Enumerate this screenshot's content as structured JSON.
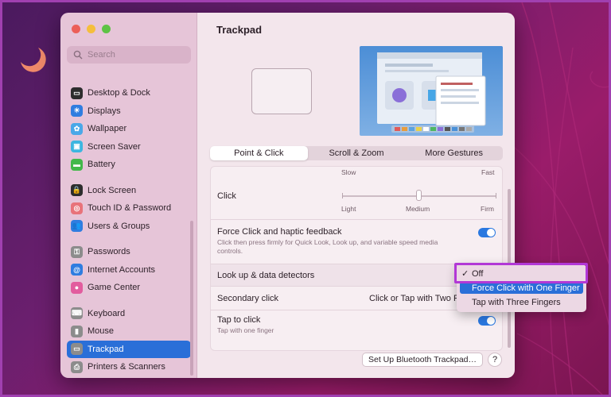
{
  "colors": {
    "accent": "#2a6fd8",
    "callout": "#b238d6",
    "traffic_close": "#ec5f58",
    "traffic_min": "#f5be3c",
    "traffic_max": "#5ec345"
  },
  "sidebar": {
    "search_placeholder": "Search",
    "items": [
      {
        "label": "Desktop & Dock",
        "icon": "dock-icon",
        "color": "#2d2d2d",
        "glyph": "▭"
      },
      {
        "label": "Displays",
        "icon": "sun-icon",
        "color": "#2f7de0",
        "glyph": "☀"
      },
      {
        "label": "Wallpaper",
        "icon": "wallpaper-icon",
        "color": "#4aa8e8",
        "glyph": "✿"
      },
      {
        "label": "Screen Saver",
        "icon": "screen-saver-icon",
        "color": "#3cb6e0",
        "glyph": "▣"
      },
      {
        "label": "Battery",
        "icon": "battery-icon",
        "color": "#42b84a",
        "glyph": "▬"
      },
      {
        "label": "Lock Screen",
        "icon": "lock-icon",
        "color": "#2d2d2d",
        "glyph": "🔒"
      },
      {
        "label": "Touch ID & Password",
        "icon": "fingerprint-icon",
        "color": "#e8737a",
        "glyph": "◎"
      },
      {
        "label": "Users & Groups",
        "icon": "users-icon",
        "color": "#2f7de0",
        "glyph": "👥"
      },
      {
        "label": "Passwords",
        "icon": "key-icon",
        "color": "#8c8c8c",
        "glyph": "⚿"
      },
      {
        "label": "Internet Accounts",
        "icon": "at-icon",
        "color": "#2f7de0",
        "glyph": "@"
      },
      {
        "label": "Game Center",
        "icon": "game-center-icon",
        "color": "#e25c9e",
        "glyph": "●"
      },
      {
        "label": "Keyboard",
        "icon": "keyboard-icon",
        "color": "#8c8c8c",
        "glyph": "⌨"
      },
      {
        "label": "Mouse",
        "icon": "mouse-icon",
        "color": "#8c8c8c",
        "glyph": "▮"
      },
      {
        "label": "Trackpad",
        "icon": "trackpad-icon",
        "color": "#8c8c8c",
        "glyph": "▭"
      },
      {
        "label": "Printers & Scanners",
        "icon": "printer-icon",
        "color": "#8c8c8c",
        "glyph": "⎙"
      }
    ]
  },
  "main": {
    "title": "Trackpad",
    "tabs": [
      "Point & Click",
      "Scroll & Zoom",
      "More Gestures"
    ],
    "tracking": {
      "slow": "Slow",
      "fast": "Fast"
    },
    "click": {
      "label": "Click",
      "light": "Light",
      "medium": "Medium",
      "firm": "Firm",
      "level": "Medium"
    },
    "force_click": {
      "label": "Force Click and haptic feedback",
      "description": "Click then press firmly for Quick Look, Look up, and variable speed media controls.",
      "enabled": true
    },
    "lookup": {
      "label": "Look up & data detectors"
    },
    "secondary": {
      "label": "Secondary click",
      "value": "Click or Tap with Two F"
    },
    "tap": {
      "label": "Tap to click",
      "description": "Tap with one finger",
      "enabled": true
    },
    "bluetooth_button": "Set Up Bluetooth Trackpad…",
    "help_button": "?"
  },
  "popup": {
    "items": [
      {
        "label": "Off",
        "checked": true
      },
      {
        "label": "Force Click with One Finger",
        "highlighted": true
      },
      {
        "label": "Tap with Three Fingers"
      }
    ],
    "check_glyph": "✓"
  }
}
